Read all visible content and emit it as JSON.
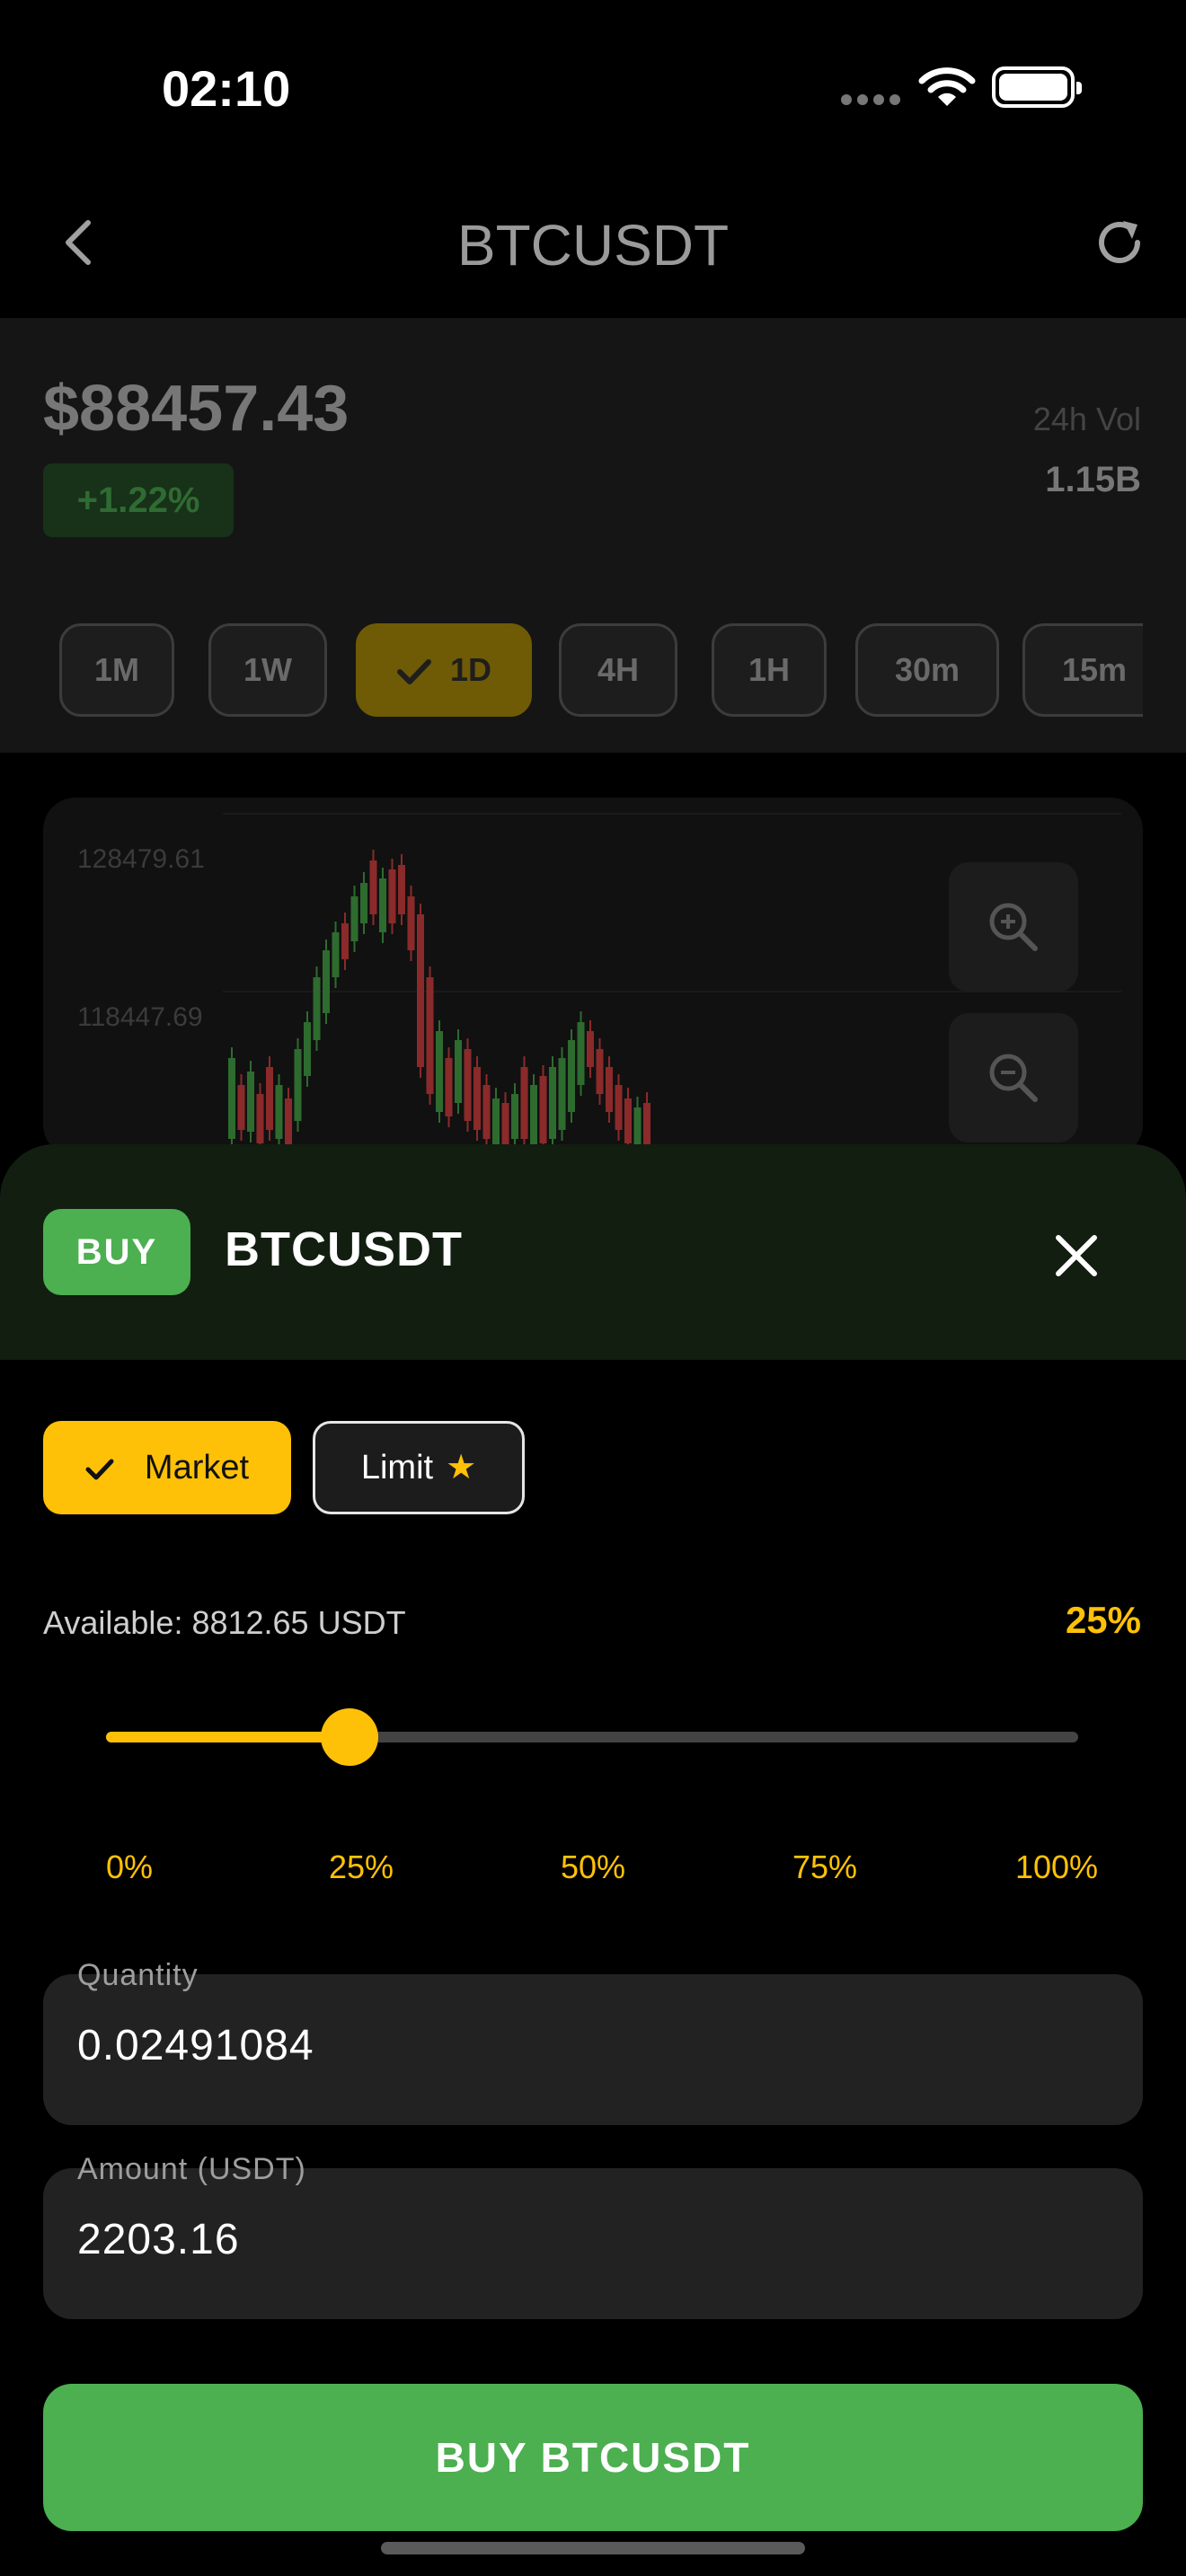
{
  "status_bar": {
    "time": "02:10"
  },
  "nav": {
    "title": "BTCUSDT"
  },
  "ticker": {
    "price": "$88457.43",
    "change": "+1.22%",
    "vol_label": "24h Vol",
    "vol_value": "1.15B"
  },
  "timeframes": [
    {
      "label": "1M",
      "active": false
    },
    {
      "label": "1W",
      "active": false
    },
    {
      "label": "1D",
      "active": true
    },
    {
      "label": "4H",
      "active": false
    },
    {
      "label": "1H",
      "active": false
    },
    {
      "label": "30m",
      "active": false
    },
    {
      "label": "15m",
      "active": false
    }
  ],
  "chart": {
    "y_labels": [
      "128479.61",
      "118447.69"
    ]
  },
  "sheet": {
    "badge": "BUY",
    "title": "BTCUSDT",
    "order_types": {
      "market": "Market",
      "limit": "Limit"
    },
    "available": "Available: 8812.65 USDT",
    "percent": "25%",
    "slider_value": 0.25,
    "slider_ticks": [
      "0%",
      "25%",
      "50%",
      "75%",
      "100%"
    ],
    "quantity_label": "Quantity",
    "quantity_value": "0.02491084",
    "amount_label": "Amount (USDT)",
    "amount_value": "2203.16",
    "submit_label": "BUY BTCUSDT"
  },
  "colors": {
    "accent": "#ffc107",
    "buy": "#4caf50",
    "up_candle": "#2e6b2f",
    "down_candle": "#8b2a2a"
  }
}
